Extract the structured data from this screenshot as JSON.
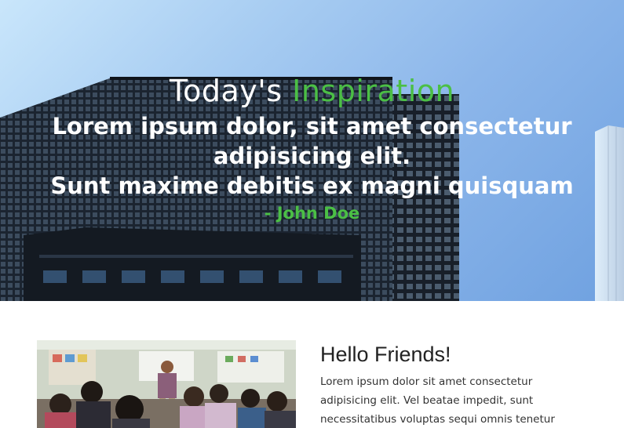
{
  "hero": {
    "title_prefix": "Today's ",
    "title_accent": "Inspiration",
    "quote_lines": [
      "Lorem ipsum dolor, sit amet consectetur",
      "adipisicing elit.",
      "Sunt maxime debitis ex magni quisquam"
    ],
    "author": "- John Doe"
  },
  "article": {
    "heading": "Hello Friends!",
    "body": "Lorem ipsum dolor sit amet consectetur adipisicing elit. Vel beatae impedit, sunt necessitatibus voluptas sequi omnis tenetur"
  },
  "colors": {
    "accent": "#4bbf45",
    "hero_text": "#ffffff",
    "sky": "#8cb6ea"
  }
}
